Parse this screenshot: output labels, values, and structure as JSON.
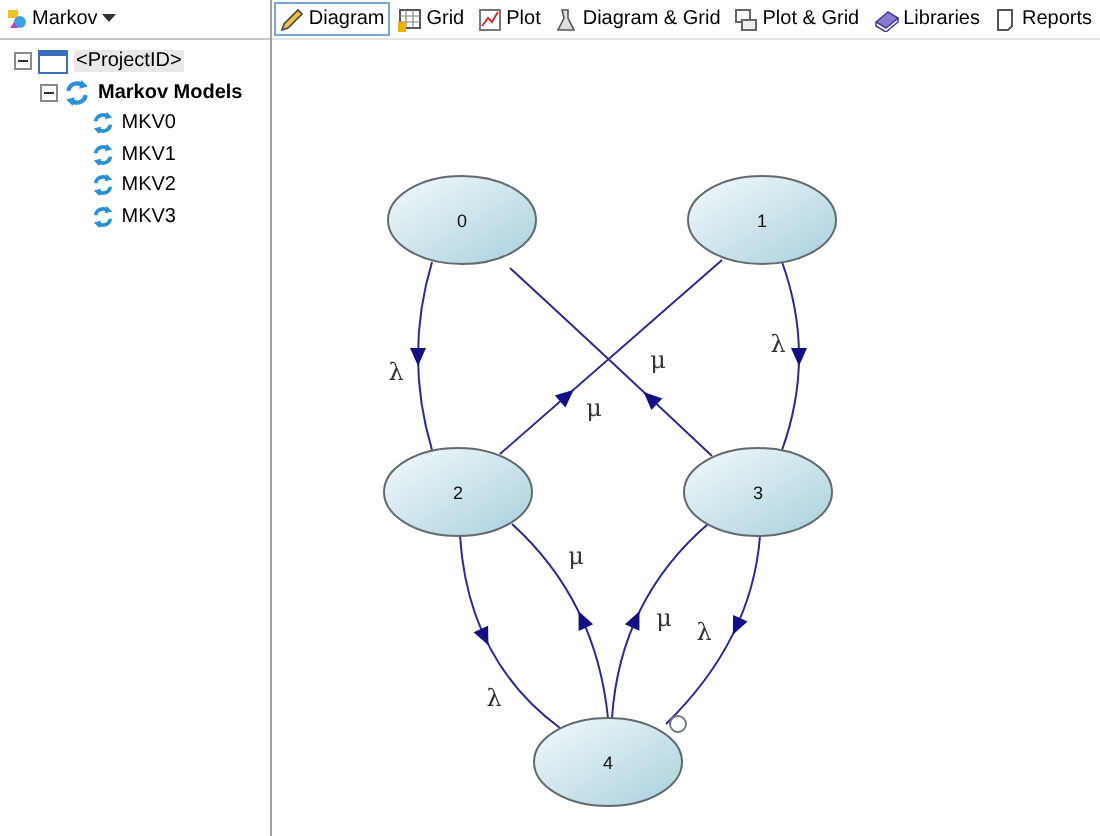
{
  "model_menu": {
    "label": "Markov"
  },
  "tree": [
    {
      "label": "<ProjectID>",
      "kind": "project",
      "selected": true,
      "expanded": true,
      "children": [
        {
          "label": "Markov Models",
          "kind": "group",
          "selected": false,
          "expanded": true,
          "children": [
            {
              "label": "MKV0",
              "kind": "model",
              "selected": false
            },
            {
              "label": "MKV1",
              "kind": "model",
              "selected": false
            },
            {
              "label": "MKV2",
              "kind": "model",
              "selected": false
            },
            {
              "label": "MKV3",
              "kind": "model",
              "selected": false
            }
          ]
        }
      ]
    }
  ],
  "tabs": [
    {
      "label": "Diagram",
      "selected": true
    },
    {
      "label": "Grid",
      "selected": false
    },
    {
      "label": "Plot",
      "selected": false
    },
    {
      "label": "Diagram & Grid",
      "selected": false
    },
    {
      "label": "Plot & Grid",
      "selected": false
    },
    {
      "label": "Libraries",
      "selected": false
    },
    {
      "label": "Reports",
      "selected": false
    }
  ],
  "diagram": {
    "nodes": [
      {
        "label": "0"
      },
      {
        "label": "1"
      },
      {
        "label": "2"
      },
      {
        "label": "3"
      },
      {
        "label": "4"
      }
    ],
    "edges": [
      {
        "label": "λ"
      },
      {
        "label": "λ"
      },
      {
        "label": "μ"
      },
      {
        "label": "μ"
      },
      {
        "label": "λ"
      },
      {
        "label": "μ"
      },
      {
        "label": "μ"
      },
      {
        "label": "λ"
      }
    ]
  }
}
